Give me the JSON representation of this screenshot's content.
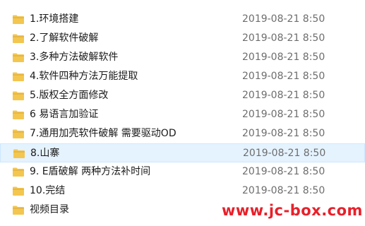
{
  "icon": "folder-icon",
  "colors": {
    "folder": "#f3c64f",
    "folder_shade": "#dba83a",
    "selected_bg": "#e5f3ff",
    "date_text": "#6d6d6d",
    "watermark": "#e8202a"
  },
  "items": [
    {
      "name": "1.环境搭建",
      "date": "2019-08-21 8:50",
      "selected": false
    },
    {
      "name": "2.了解软件破解",
      "date": "2019-08-21 8:50",
      "selected": false
    },
    {
      "name": "3.多种方法破解软件",
      "date": "2019-08-21 8:50",
      "selected": false
    },
    {
      "name": "4.软件四种方法万能提取",
      "date": "2019-08-21 8:50",
      "selected": false
    },
    {
      "name": "5.版权全方面修改",
      "date": "2019-08-21 8:50",
      "selected": false
    },
    {
      "name": "6 易语言加验证",
      "date": "2019-08-21 8:50",
      "selected": false
    },
    {
      "name": "7.通用加壳软件破解 需要驱动OD",
      "date": "2019-08-21 8:50",
      "selected": false
    },
    {
      "name": "8.山寨",
      "date": "2019-08-21 8:50",
      "selected": true
    },
    {
      "name": "9. E盾破解 两种方法补时间",
      "date": "2019-08-21 8:50",
      "selected": false
    },
    {
      "name": "10.完结",
      "date": "2019-08-21 8:50",
      "selected": false
    },
    {
      "name": "视频目录",
      "date": "",
      "selected": false
    }
  ],
  "watermark": "www.jc-box.com"
}
